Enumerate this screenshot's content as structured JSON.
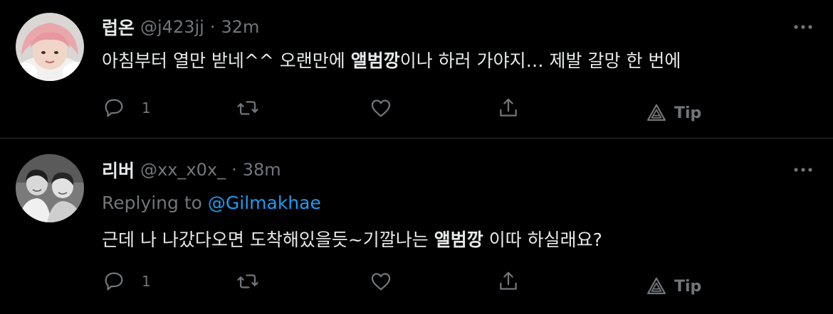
{
  "tweets": [
    {
      "name": "럽온",
      "handle": "@j423jj",
      "separator": "·",
      "time": "32m",
      "text_before": "아침부터 열만 받네^^ 오랜만에 ",
      "text_bold": "앨범깡",
      "text_after": "이나 하러 가야지… 제발 갈망 한 번에",
      "reply_count": "1",
      "tip_label": "Tip"
    },
    {
      "name": "리버",
      "handle": "@xx_x0x_",
      "separator": "·",
      "time": "38m",
      "replying_prefix": "Replying to ",
      "replying_to": "@Gilmakhae",
      "text_before": "근데 나 나갔다오면 도착해있을듯~기깔나는 ",
      "text_bold": "앨범깡",
      "text_after": " 이따 하실래요?",
      "reply_count": "1",
      "tip_label": "Tip"
    }
  ],
  "colors": {
    "background": "#000000",
    "primary_text": "#e7e9ea",
    "secondary_text": "#71767b",
    "mention": "#1d9bf0",
    "divider": "#2f3336"
  },
  "icons": {
    "more": "more-dots-icon",
    "reply": "reply-bubble-icon",
    "retweet": "retweet-arrows-icon",
    "like": "heart-icon",
    "share": "share-upload-icon",
    "tip": "tip-triangle-icon"
  }
}
